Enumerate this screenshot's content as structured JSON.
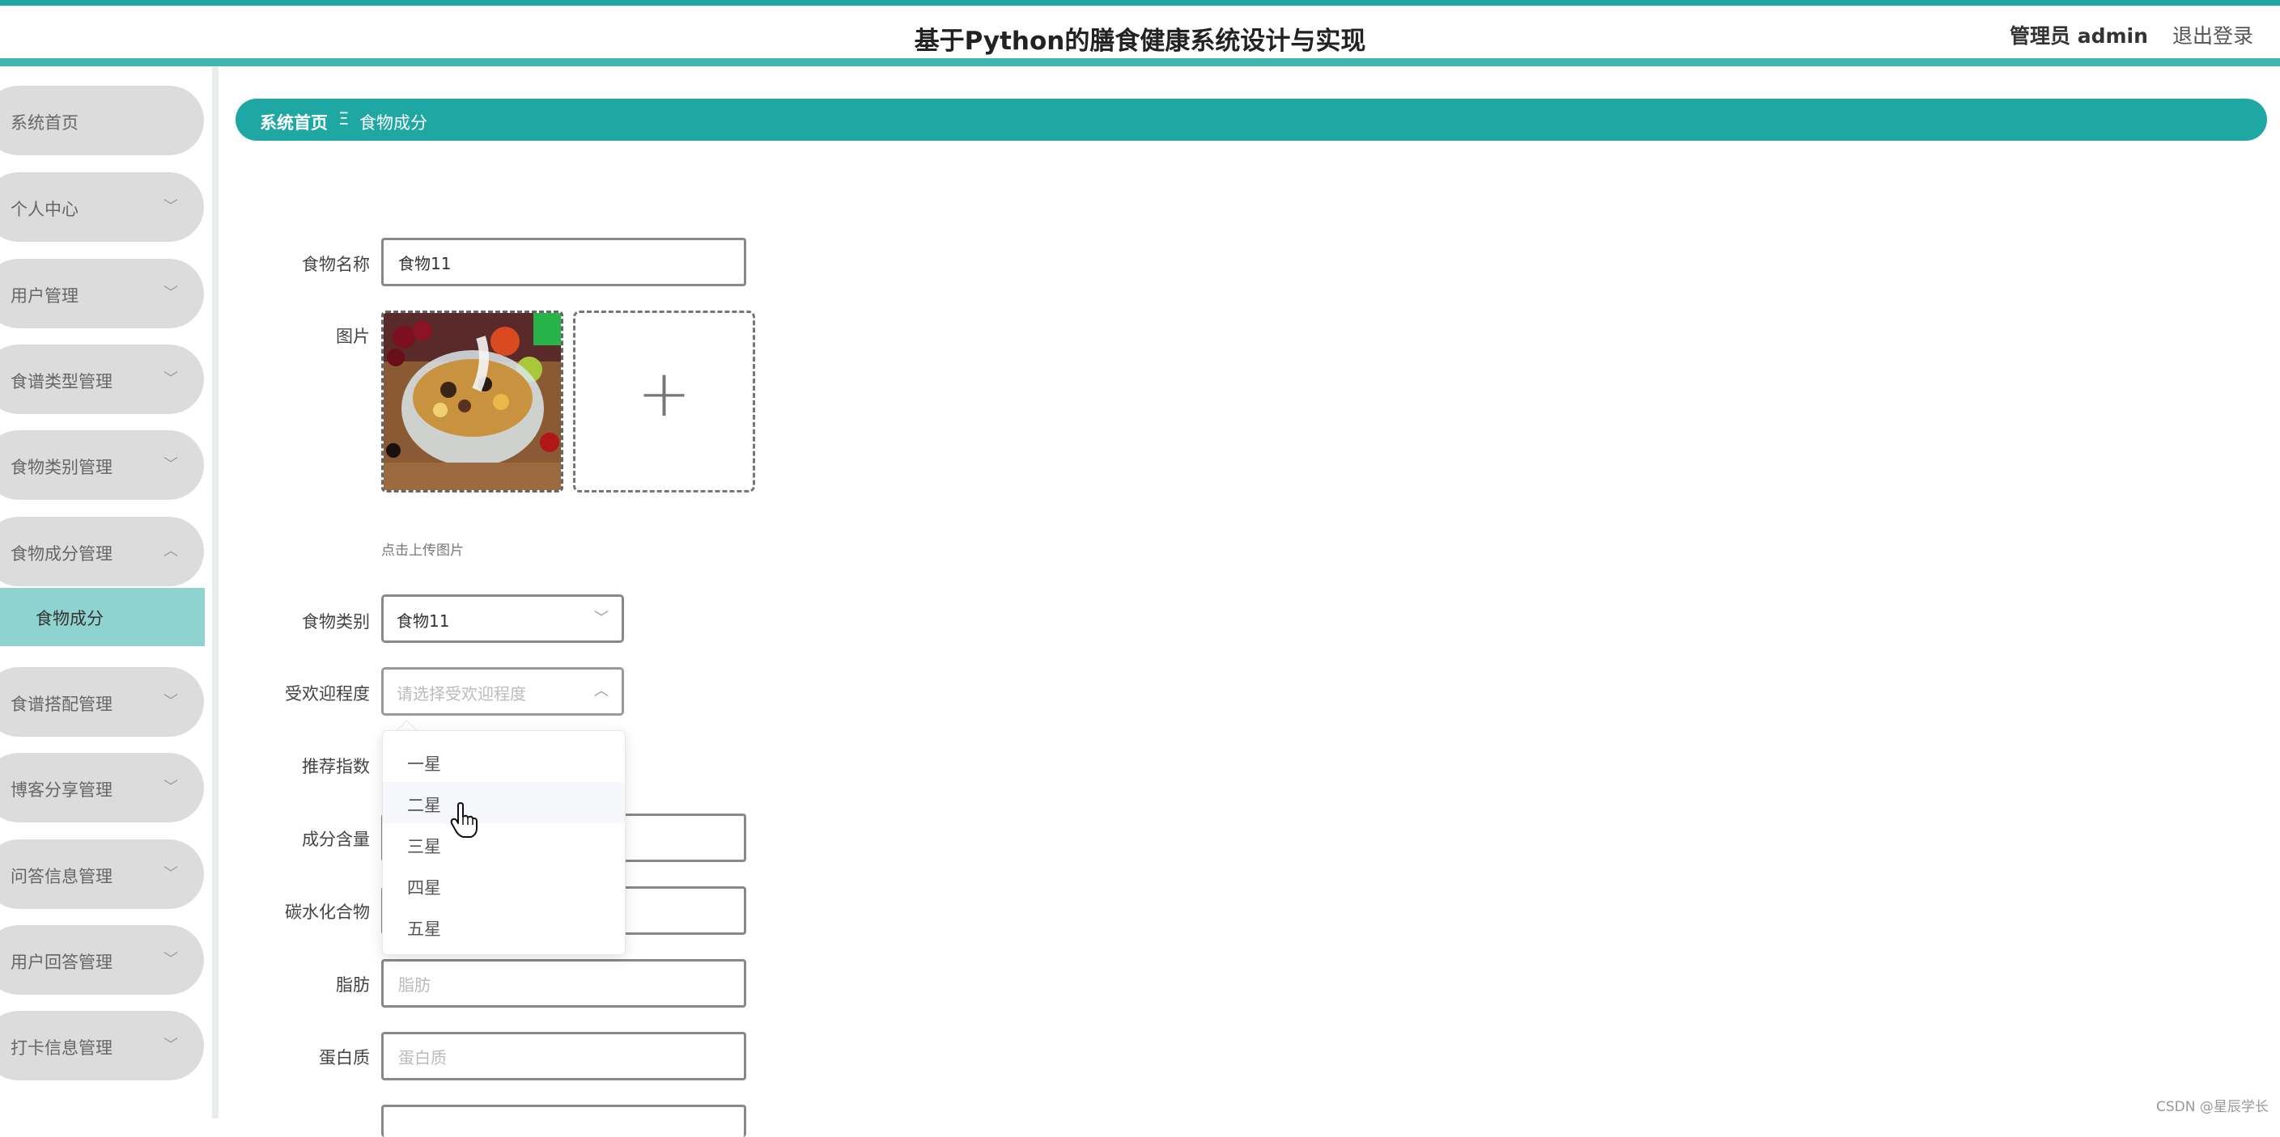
{
  "header": {
    "title": "基于Python的膳食健康系统设计与实现",
    "user_label": "管理员 admin",
    "logout_label": "退出登录"
  },
  "sidebar": {
    "items": [
      {
        "label": "系统首页",
        "chevron": ""
      },
      {
        "label": "个人中心",
        "chevron": "﹀"
      },
      {
        "label": "用户管理",
        "chevron": "﹀"
      },
      {
        "label": "食谱类型管理",
        "chevron": "﹀"
      },
      {
        "label": "食物类别管理",
        "chevron": "﹀"
      },
      {
        "label": "食物成分管理",
        "chevron": "︿"
      },
      {
        "label": "食谱搭配管理",
        "chevron": "﹀"
      },
      {
        "label": "博客分享管理",
        "chevron": "﹀"
      },
      {
        "label": "问答信息管理",
        "chevron": "﹀"
      },
      {
        "label": "用户回答管理",
        "chevron": "﹀"
      },
      {
        "label": "打卡信息管理",
        "chevron": "﹀"
      }
    ],
    "active_sub": "食物成分"
  },
  "breadcrumb": {
    "home": "系统首页",
    "separator": "Ξ",
    "current": "食物成分"
  },
  "form": {
    "food_name": {
      "label": "食物名称",
      "value": "食物11"
    },
    "image": {
      "label": "图片",
      "hint": "点击上传图片",
      "upload_icon": "+"
    },
    "category": {
      "label": "食物类别",
      "value": "食物11"
    },
    "popularity": {
      "label": "受欢迎程度",
      "placeholder": "请选择受欢迎程度",
      "options": [
        "一星",
        "二星",
        "三星",
        "四星",
        "五星"
      ],
      "hovered_option": "二星"
    },
    "recommend": {
      "label": "推荐指数"
    },
    "content": {
      "label": "成分含量"
    },
    "carbs": {
      "label": "碳水化合物"
    },
    "fat": {
      "label": "脂肪",
      "placeholder": "脂肪"
    },
    "protein": {
      "label": "蛋白质",
      "placeholder": "蛋白质"
    }
  },
  "watermark": "CSDN @星辰学长",
  "colors": {
    "accent": "#1fa8a3",
    "sidebar_item": "#dcdcdc",
    "sidebar_active": "#8fd3d0"
  }
}
